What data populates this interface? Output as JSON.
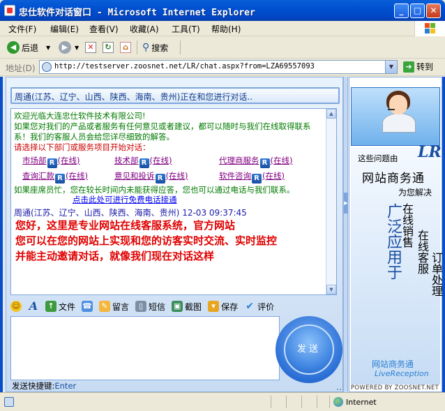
{
  "window": {
    "title": "忠仕软件对话窗口 - Microsoft Internet Explorer",
    "controls": {
      "minimize": "_",
      "maximize": "□",
      "close": "✕"
    }
  },
  "menu": [
    "文件(F)",
    "编辑(E)",
    "查看(V)",
    "收藏(A)",
    "工具(T)",
    "帮助(H)"
  ],
  "toolbar": {
    "back": "后退",
    "search": "搜索"
  },
  "address": {
    "label": "地址(D)",
    "url": "http://testserver.zoosnet.net/LR/chat.aspx?from=LZA69557093",
    "go": "转到"
  },
  "chat": {
    "status": "周通(江苏、辽宁、山西、陕西、海南、贵州)正在和您进行对话..",
    "welcome": "欢迎光临大连忠仕软件技术有限公司!",
    "intro1": "如果您对我们的产品或者服务有任何意见或者建议，都可以随时与我们在线取得联系",
    "intro2": "系！我们的客服人员会给您详尽细致的解答。",
    "prompt": "请选择以下部门或服务项目开始对话：",
    "departments": [
      {
        "name": "市场部",
        "status": "(在线)"
      },
      {
        "name": "技术部",
        "status": "(在线)"
      },
      {
        "name": "代理商服务",
        "status": "(在线)"
      },
      {
        "name": "查询汇款",
        "status": "(在线)"
      },
      {
        "name": "意见和投诉",
        "status": "(在线)"
      },
      {
        "name": "软件咨询",
        "status": "(在线)"
      }
    ],
    "busy_note": "如果座席员忙，您在较长时间内未能获得应答，您也可以通过电话与我们联系。",
    "phone_link": "点击此处可进行免费电话接通",
    "message": {
      "sender": "周通(江苏、辽宁、山西、陕西、海南、贵州)",
      "time": "12-03 09:37:45",
      "lines": [
        "您好，这里是专业网站在线客服系统，官方网站",
        "您可以在您的网站上实现和您的访客实时交流、实时监控",
        "并能主动邀请对话，就像我们现在对话这样"
      ]
    },
    "lr_badge": "R"
  },
  "tools": [
    {
      "icon": "smile-icon",
      "label": "",
      "glyph": "☺"
    },
    {
      "icon": "font-icon",
      "label": "",
      "glyph": "A"
    },
    {
      "icon": "file-icon",
      "label": "文件",
      "glyph": "↑"
    },
    {
      "icon": "phone-icon",
      "label": "",
      "glyph": "☎"
    },
    {
      "icon": "note-icon",
      "label": "留言",
      "glyph": "✎"
    },
    {
      "icon": "sms-icon",
      "label": "短信",
      "glyph": "▯"
    },
    {
      "icon": "capture-icon",
      "label": "截图",
      "glyph": "▣"
    },
    {
      "icon": "save-icon",
      "label": "保存",
      "glyph": "▾"
    },
    {
      "icon": "rate-icon",
      "label": "评价",
      "glyph": "✔"
    }
  ],
  "send": {
    "label": "发送",
    "shortcut_label": "发送快捷键:",
    "shortcut_key": "Enter"
  },
  "ad": {
    "question": "这些问题由",
    "logo": "LR",
    "title": "网站商务通",
    "subtitle": "为您解决",
    "col1": "广泛应用于",
    "col2": "在线销售",
    "col3": "在线客服",
    "col4": "订单处理",
    "brand": "网站商务通",
    "brand_en": "LiveReception",
    "powered": "POWERED BY ZOOSNET.NET"
  },
  "statusbar": {
    "zone": "Internet"
  }
}
